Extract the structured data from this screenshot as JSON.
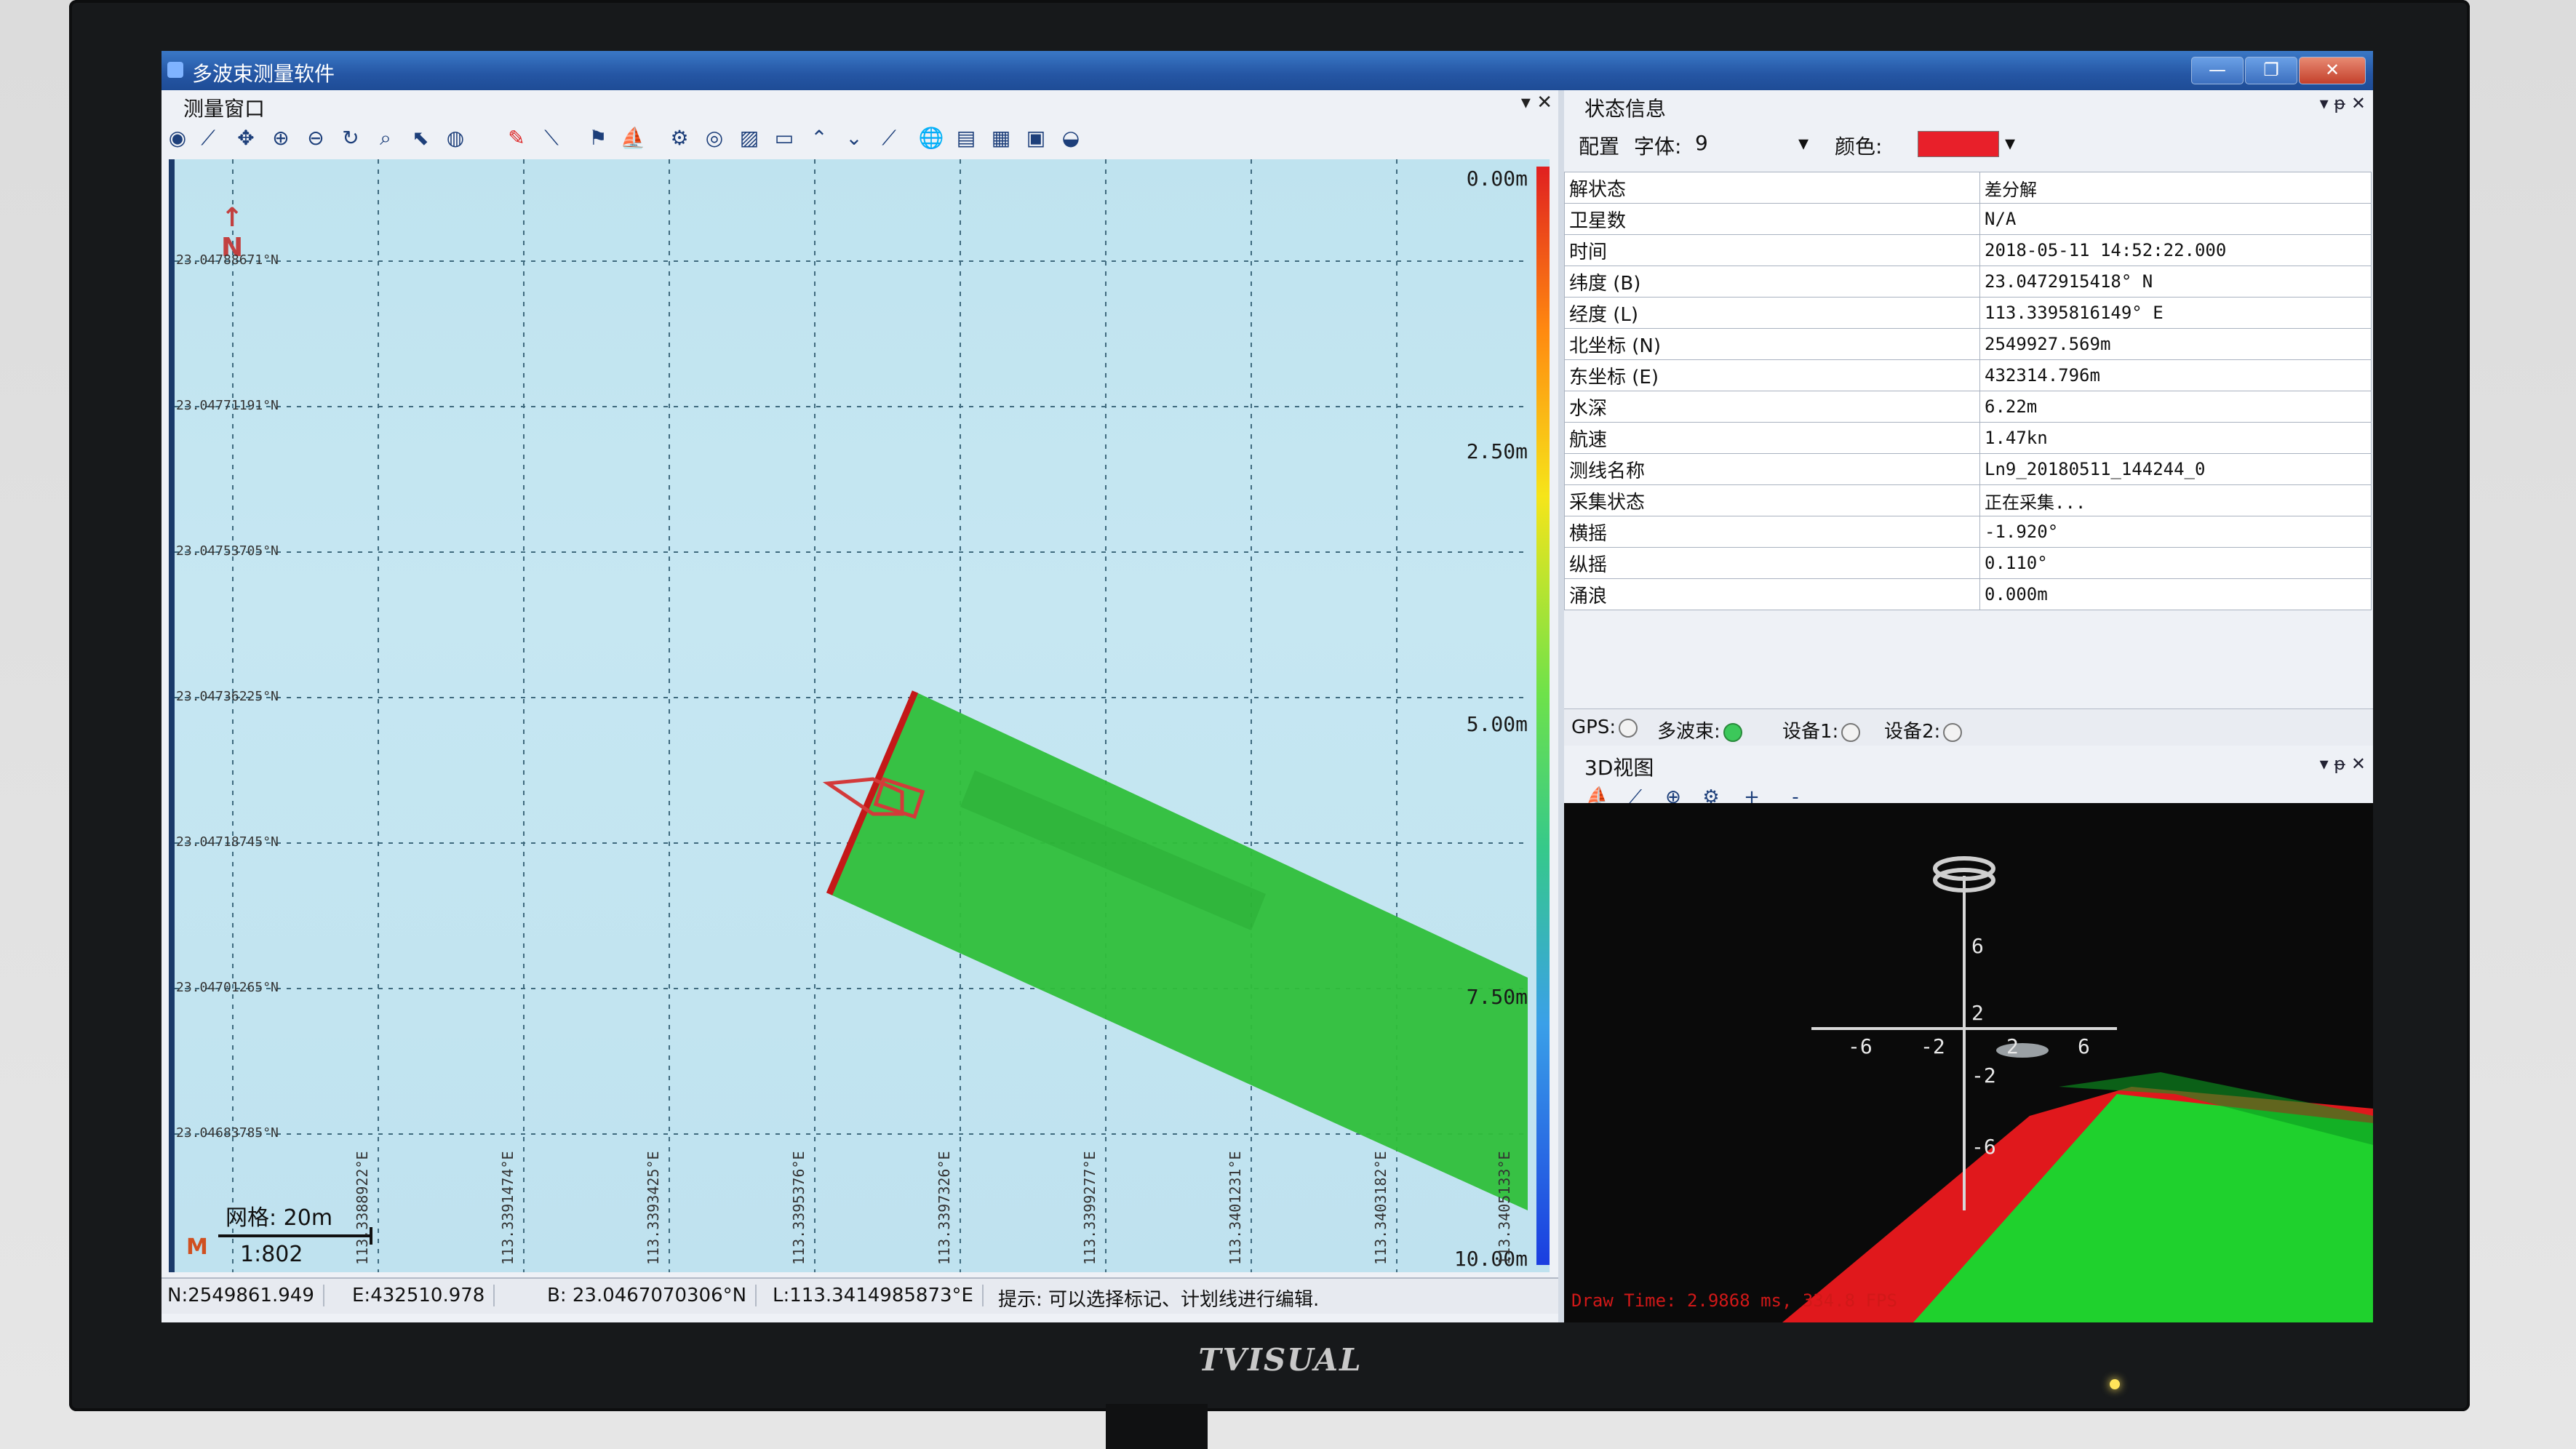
{
  "window": {
    "title": "多波束测量软件",
    "left_panel_title": "测量窗口",
    "panel_controls": "▾ ✕",
    "min_icon": "—",
    "max_icon": "❐",
    "close_icon": "✕"
  },
  "toolbar_icons": [
    "record-icon",
    "measure-icon",
    "pan-icon",
    "zoom-in-icon",
    "zoom-out-icon",
    "rotate-icon",
    "zoom-fit-icon",
    "select-icon",
    "globe-icon",
    "pin-icon",
    "ruler-icon",
    "mark-icon",
    "ship-icon",
    "settings-icon",
    "target-icon",
    "hatch-icon",
    "rect-icon",
    "up-icon",
    "down-icon",
    "line-icon",
    "earth-icon",
    "layers-icon",
    "palette-icon",
    "monitor-icon",
    "disk-icon"
  ],
  "map": {
    "depth_ticks": [
      "0.00m",
      "2.50m",
      "5.00m",
      "7.50m",
      "10.00m"
    ],
    "lat_labels": [
      "23.04788671°N",
      "23.04771191°N",
      "23.04753705°N",
      "23.04736225°N",
      "23.04718745°N",
      "23.04701265°N",
      "23.04683785°N"
    ],
    "lon_labels": [
      "113.3388922°E",
      "113.3391474°E",
      "113.3393425°E",
      "113.3395376°E",
      "113.3397326°E",
      "113.3399277°E",
      "113.3401231°E",
      "113.3403182°E",
      "113.3405133°E"
    ],
    "north_label": "N",
    "scale_grid": "网格: 20m",
    "scale_ratio": "1:802",
    "scale_mark": "M"
  },
  "statusbar": {
    "north": "N:2549861.949",
    "east": "E:432510.978",
    "lat": "B: 23.0467070306°N",
    "lon": "L:113.3414985873°E",
    "hint": "提示: 可以选择标记、计划线进行编辑."
  },
  "status_panel": {
    "title": "状态信息",
    "controls": "▾ ᵽ ✕",
    "config_label": "配置",
    "font_label": "字体:",
    "font_value": "9",
    "color_label": "颜色:",
    "color_value": "#e8202a",
    "rows": [
      {
        "key": "解状态",
        "value": "差分解"
      },
      {
        "key": "卫星数",
        "value": "N/A"
      },
      {
        "key": "时间",
        "value": "2018-05-11 14:52:22.000"
      },
      {
        "key": "纬度 (B)",
        "value": " 23.0472915418° N"
      },
      {
        "key": "经度 (L)",
        "value": "113.3395816149° E"
      },
      {
        "key": "北坐标 (N)",
        "value": "2549927.569m"
      },
      {
        "key": "东坐标 (E)",
        "value": "432314.796m"
      },
      {
        "key": "水深",
        "value": "6.22m"
      },
      {
        "key": "航速",
        "value": "1.47kn"
      },
      {
        "key": "测线名称",
        "value": "Ln9_20180511_144244_0"
      },
      {
        "key": "采集状态",
        "value": "正在采集..."
      },
      {
        "key": "横摇",
        "value": "-1.920°"
      },
      {
        "key": "纵摇",
        "value": "0.110°"
      },
      {
        "key": "涌浪",
        "value": "0.000m"
      }
    ],
    "gps_label": "GPS:",
    "multibeam_label": "多波束:",
    "device1_label": "设备1:",
    "device2_label": "设备2:"
  },
  "view3d": {
    "title": "3D视图",
    "controls": "▾ ᵽ ✕",
    "tools": [
      "ship-icon",
      "draw-icon",
      "zoom-icon",
      "settings-icon",
      "+",
      "-"
    ],
    "x_labels": [
      "-6",
      "-2",
      "2",
      "6"
    ],
    "y_labels": [
      "6",
      "2",
      "-2",
      "-6"
    ],
    "fps_text": "Draw Time: 2.9868 ms, 334.8 FPS"
  },
  "brand": "TVISUAL",
  "colors": {
    "titlebar": "#2556a4",
    "swath": "#2fbf3a",
    "seafloor_red": "#e0181c",
    "ship_outline": "#d33a3a"
  }
}
